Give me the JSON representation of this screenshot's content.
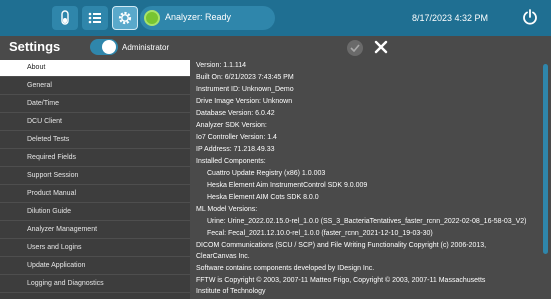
{
  "topbar": {
    "status_text": "Analyzer: Ready",
    "datetime": "8/17/2023 4:32 PM"
  },
  "header": {
    "title": "Settings",
    "admin_label": "Administrator"
  },
  "sidebar": {
    "items": [
      {
        "label": "About",
        "selected": true
      },
      {
        "label": "General"
      },
      {
        "label": "Date/Time"
      },
      {
        "label": "DCU Client"
      },
      {
        "label": "Deleted Tests"
      },
      {
        "label": "Required Fields"
      },
      {
        "label": "Support Session"
      },
      {
        "label": "Product Manual"
      },
      {
        "label": "Dilution Guide"
      },
      {
        "label": "Analyzer Management"
      },
      {
        "label": "Users and Logins"
      },
      {
        "label": "Update Application"
      },
      {
        "label": "Logging and Diagnostics"
      }
    ]
  },
  "about": {
    "lines": [
      {
        "text": "Version: 1.1.114"
      },
      {
        "text": "Built On: 6/21/2023 7:43:45 PM"
      },
      {
        "text": "Instrument ID: Unknown_Demo"
      },
      {
        "text": "Drive Image Version: Unknown"
      },
      {
        "text": "Database Version: 6.0.42"
      },
      {
        "text": "Analyzer SDK Version:"
      },
      {
        "text": "Io7 Controller Version: 1.4"
      },
      {
        "text": "IP Address: 71.218.49.33"
      },
      {
        "text": "Installed Components:"
      },
      {
        "text": "Cuattro Update Registry (x86) 1.0.003",
        "indent": true
      },
      {
        "text": "Heska Element Aim InstrumentControl SDK 9.0.009",
        "indent": true
      },
      {
        "text": "Heska Element AIM Cots SDK 8.0.0",
        "indent": true
      },
      {
        "text": "ML Model Versions:"
      },
      {
        "text": "Urine: Urine_2022.02.15.0-rel_1.0.0 (SS_3_BacteriaTentatives_faster_rcnn_2022-02-08_16-58-03_V2)",
        "indent": true
      },
      {
        "text": "Fecal: Fecal_2021.12.10.0-rel_1.0.0 (faster_rcnn_2021-12-10_19-03-30)",
        "indent": true
      },
      {
        "text": "DICOM Communications (SCU / SCP) and File Writing Functionality Copyright (c) 2006-2013,"
      },
      {
        "text": "ClearCanvas Inc."
      },
      {
        "text": "Software contains components developed by IDesign Inc."
      },
      {
        "text": "FFTW is Copyright © 2003, 2007-11 Matteo Frigo, Copyright © 2003, 2007-11 Massachusetts"
      },
      {
        "text": "Institute of Technology"
      }
    ]
  },
  "icons": {
    "vial": "vial-icon",
    "list": "list-icon",
    "gear": "gear-icon",
    "status": "status-dot-icon",
    "power": "power-icon",
    "check": "checkmark-icon",
    "close": "close-icon"
  },
  "colors": {
    "topbar": "#1f6f92",
    "accent": "#2f86ab",
    "status_ready": "#78c431",
    "panel": "#4a4a4a",
    "sidebar": "#3d3d3d"
  }
}
